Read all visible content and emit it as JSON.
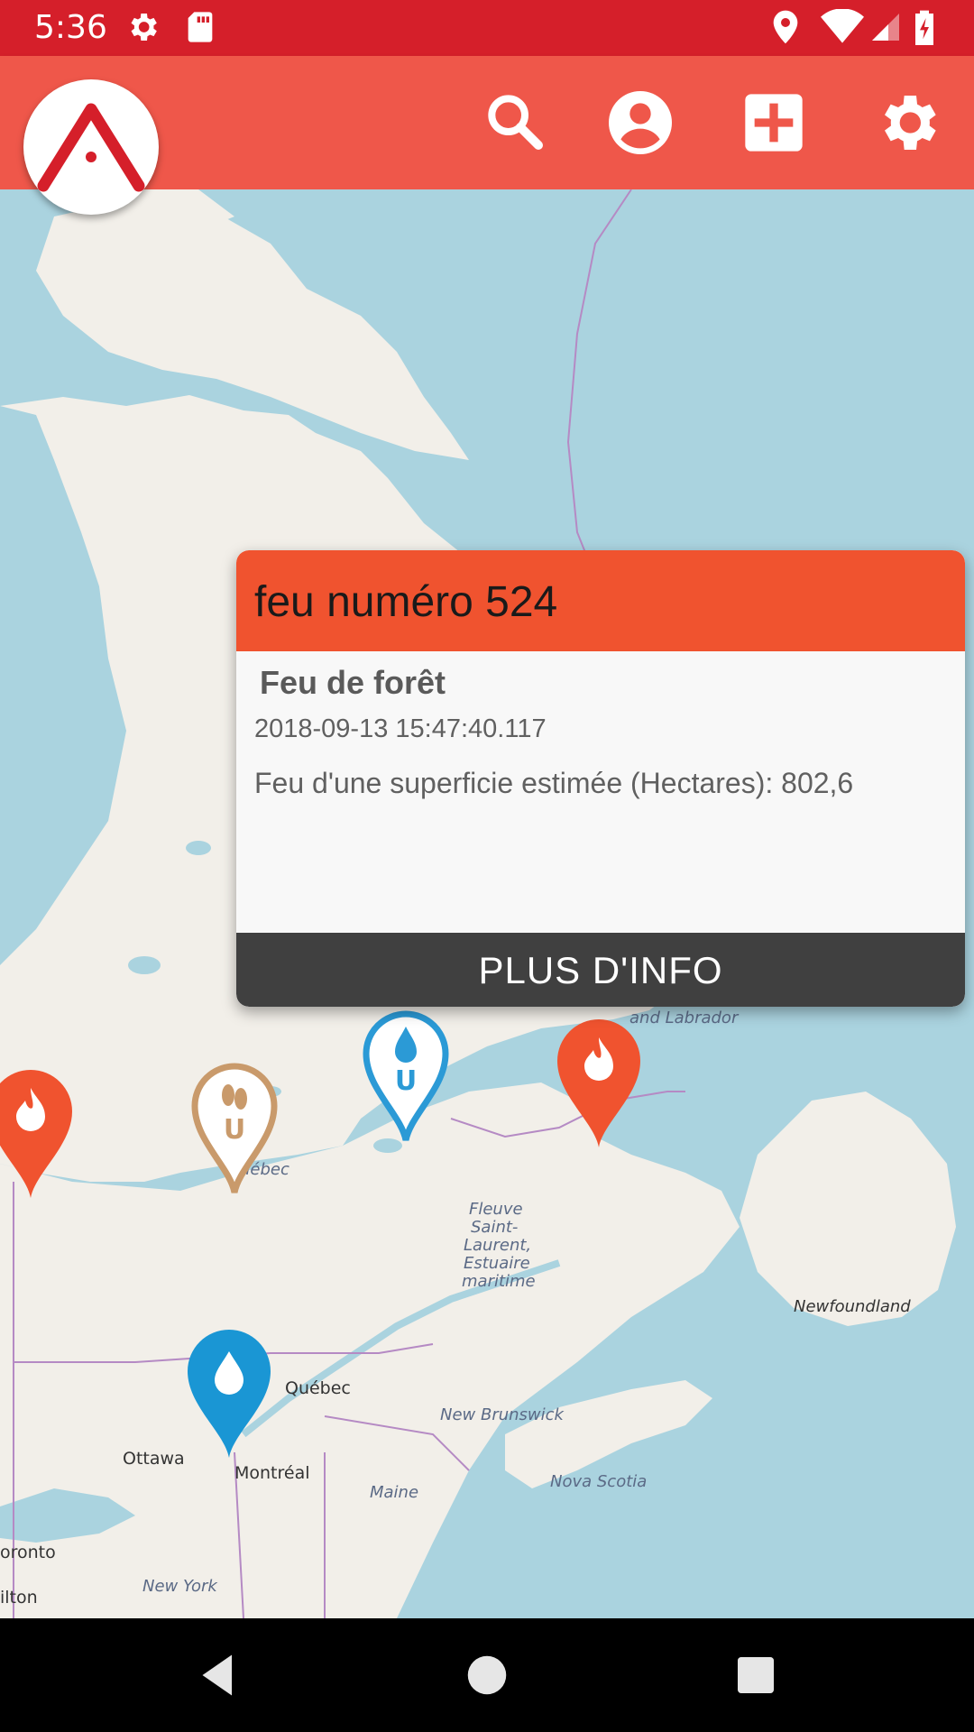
{
  "status_bar": {
    "time": "5:36",
    "icons": [
      "settings-icon",
      "sd-card-icon",
      "location-icon",
      "wifi-icon",
      "signal-icon",
      "battery-charging-icon"
    ]
  },
  "app_bar": {
    "logo": "app-logo-a-icon",
    "actions": [
      "search-icon",
      "account-icon",
      "add-box-icon",
      "settings-icon"
    ]
  },
  "popup": {
    "title": "feu numéro 524",
    "type": "Feu de forêt",
    "datetime": "2018-09-13 15:47:40.117",
    "description": "Feu d'une superficie estimée (Hectares): 802,6",
    "button_label": "PLUS D'INFO"
  },
  "map": {
    "labels": {
      "labrador": "and Labrador",
      "quebec_region": "uébec",
      "fleuve_1": "Fleuve",
      "fleuve_2": "Saint-",
      "fleuve_3": "Laurent,",
      "fleuve_4": "Estuaire",
      "fleuve_5": "maritime",
      "newfoundland": "Newfoundland",
      "quebec_city": "Québec",
      "new_brunswick": "New Brunswick",
      "ottawa": "Ottawa",
      "montreal": "Montréal",
      "nova_scotia": "Nova Scotia",
      "maine": "Maine",
      "toronto": "oronto",
      "new_york": "New York",
      "hamilton": "ilton"
    },
    "markers": [
      {
        "type": "fire",
        "icon": "fire-icon",
        "color": "#f0532f"
      },
      {
        "type": "water-unit",
        "icon": "water-drop-icon",
        "color": "#2b9ad6",
        "letter": "U"
      },
      {
        "type": "footprint-unit",
        "icon": "footprints-icon",
        "color": "#c99a6b",
        "letter": "U"
      },
      {
        "type": "fire",
        "icon": "fire-icon",
        "color": "#f0532f"
      },
      {
        "type": "water",
        "icon": "water-drop-icon",
        "color": "#1a96d4"
      }
    ],
    "colors": {
      "water": "#aad3df",
      "land": "#f2efe9",
      "border": "#b58ac4"
    }
  },
  "nav_bar": {
    "buttons": [
      "back-icon",
      "home-icon",
      "recents-icon"
    ]
  },
  "colors": {
    "status_bar": "#d51f2a",
    "app_bar": "#ef574a",
    "popup_header": "#f0532f",
    "popup_button": "#404040"
  }
}
